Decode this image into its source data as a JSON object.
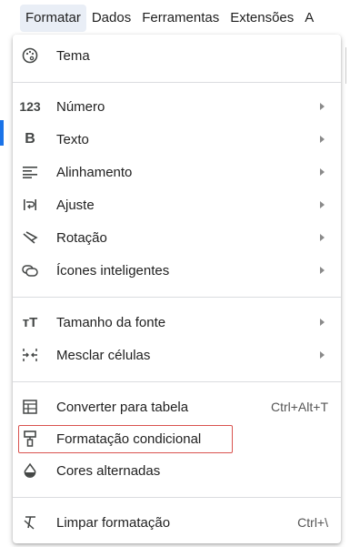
{
  "menubar": {
    "items": [
      "Formatar",
      "Dados",
      "Ferramentas",
      "Extensões",
      "A"
    ]
  },
  "menu": {
    "tema": "Tema",
    "numero": "Número",
    "texto": "Texto",
    "alinhamento": "Alinhamento",
    "ajuste": "Ajuste",
    "rotacao": "Rotação",
    "icones": "Ícones inteligentes",
    "tamanho": "Tamanho da fonte",
    "mesclar": "Mesclar células",
    "converter": "Converter para tabela",
    "converter_shortcut": "Ctrl+Alt+T",
    "formatacao_condicional": "Formatação condicional",
    "cores": "Cores alternadas",
    "limpar": "Limpar formatação",
    "limpar_shortcut": "Ctrl+\\",
    "numero_icon_text": "123",
    "texto_icon_text": "B",
    "tamanho_icon_text": "тT"
  },
  "colors": {
    "highlight_border": "#d9534f",
    "menubar_active": "#e9eef6",
    "accent_blue": "#1a73e8"
  }
}
